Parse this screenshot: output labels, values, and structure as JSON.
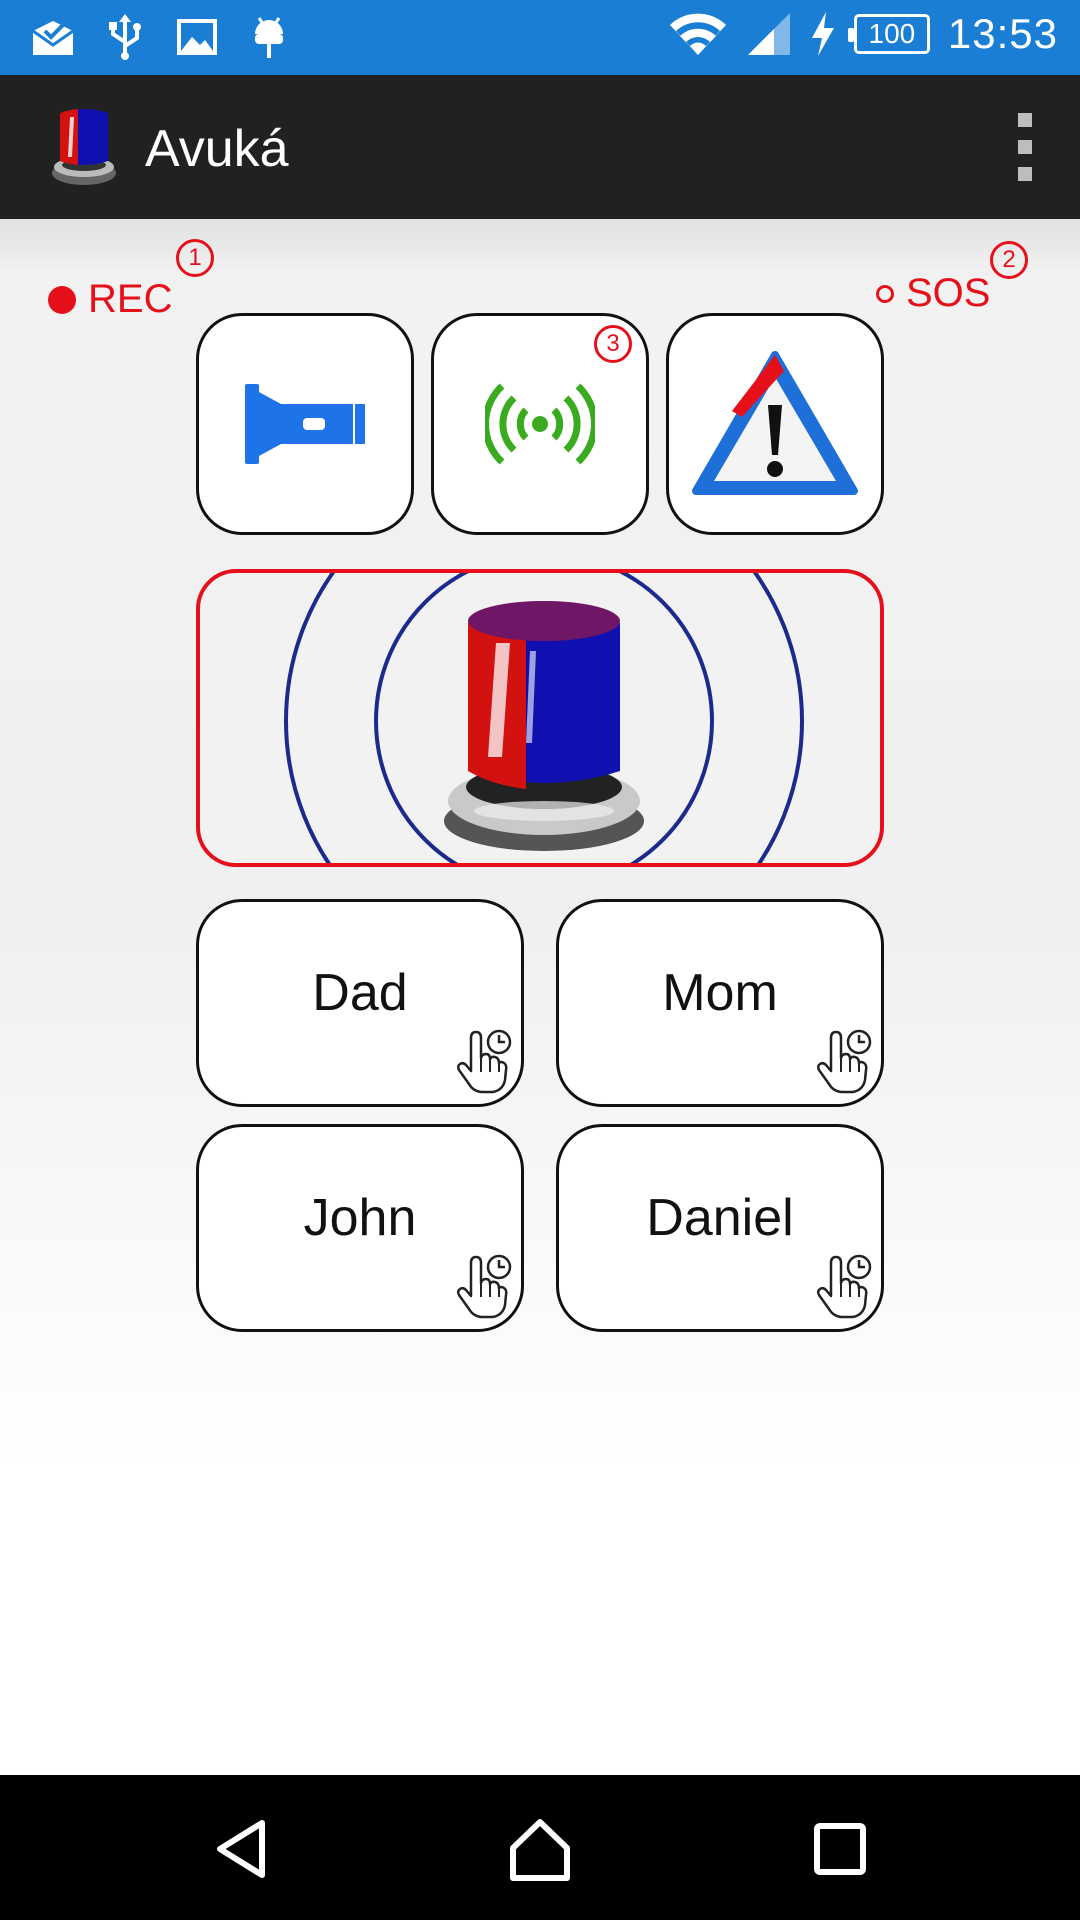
{
  "status_bar": {
    "battery_level": "100",
    "time": "13:53",
    "left_icons": [
      "mail-check-icon",
      "usb-icon",
      "image-icon",
      "android-debug-icon"
    ],
    "right_icons": [
      "wifi-icon",
      "cell-signal-icon",
      "charging-icon",
      "battery-icon"
    ]
  },
  "app_bar": {
    "title": "Avuká",
    "logo_icon": "siren-icon",
    "menu_icon": "overflow-menu-icon"
  },
  "indicators": {
    "rec_label": "REC",
    "sos_label": "SOS",
    "badges": [
      "1",
      "2",
      "3"
    ]
  },
  "actions": [
    {
      "icon": "flashlight-icon"
    },
    {
      "icon": "signal-broadcast-icon"
    },
    {
      "icon": "warning-triangle-icon"
    }
  ],
  "siren": {
    "icon": "siren-icon"
  },
  "contacts": [
    {
      "name": "Dad"
    },
    {
      "name": "Mom"
    },
    {
      "name": "John"
    },
    {
      "name": "Daniel"
    }
  ],
  "colors": {
    "status_bar": "#1a7fd4",
    "app_bar": "#212121",
    "accent_red": "#e6101b",
    "ring_blue": "#1b2a8c",
    "flashlight_blue": "#1e73e8",
    "signal_green": "#3aab1e"
  },
  "nav_bar": {
    "icons": [
      "back-icon",
      "home-icon",
      "recents-icon"
    ]
  }
}
